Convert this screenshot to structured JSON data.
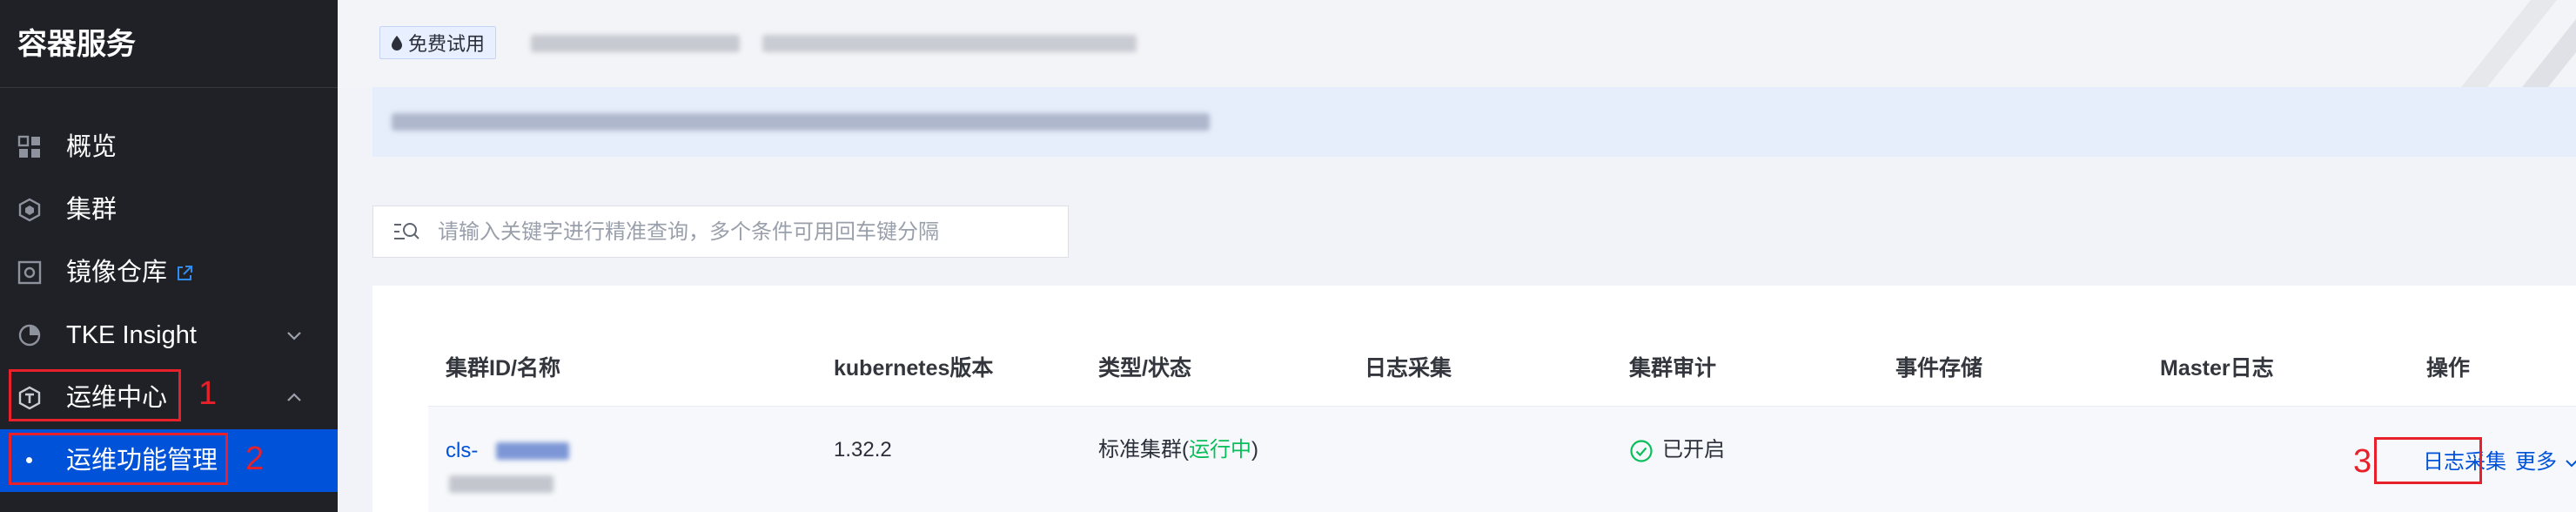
{
  "sidebar": {
    "title": "容器服务",
    "items": [
      {
        "label": "概览",
        "icon": "dashboard-grid-icon"
      },
      {
        "label": "集群",
        "icon": "cluster-hexagon-icon"
      },
      {
        "label": "镜像仓库",
        "icon": "image-registry-icon",
        "external": true
      },
      {
        "label": "TKE Insight",
        "icon": "pie-chart-icon",
        "expand": "chevron-down-icon"
      },
      {
        "label": "运维中心",
        "icon": "ops-center-icon",
        "expand": "chevron-up-icon"
      },
      {
        "label": "运维功能管理",
        "active": true
      }
    ]
  },
  "annotations": [
    "1",
    "2",
    "3"
  ],
  "header": {
    "trial_badge": "免费试用"
  },
  "search": {
    "placeholder": "请输入关键字进行精准查询，多个条件可用回车键分隔"
  },
  "table": {
    "columns": [
      "集群ID/名称",
      "kubernetes版本",
      "类型/状态",
      "日志采集",
      "集群审计",
      "事件存储",
      "Master日志",
      "操作"
    ],
    "rows": [
      {
        "cluster_id_prefix": "cls-",
        "version": "1.32.2",
        "type": "标准集群",
        "status_open": "(",
        "status": "运行中",
        "status_close": ")",
        "audit": "已开启",
        "action_primary": "日志采集",
        "action_more": "更多"
      }
    ]
  },
  "colors": {
    "sidebar_bg": "#1f2127",
    "active_bg": "#0052d9",
    "link": "#0052d9",
    "success": "#0abf5b",
    "annotation_red": "#e8202a"
  }
}
